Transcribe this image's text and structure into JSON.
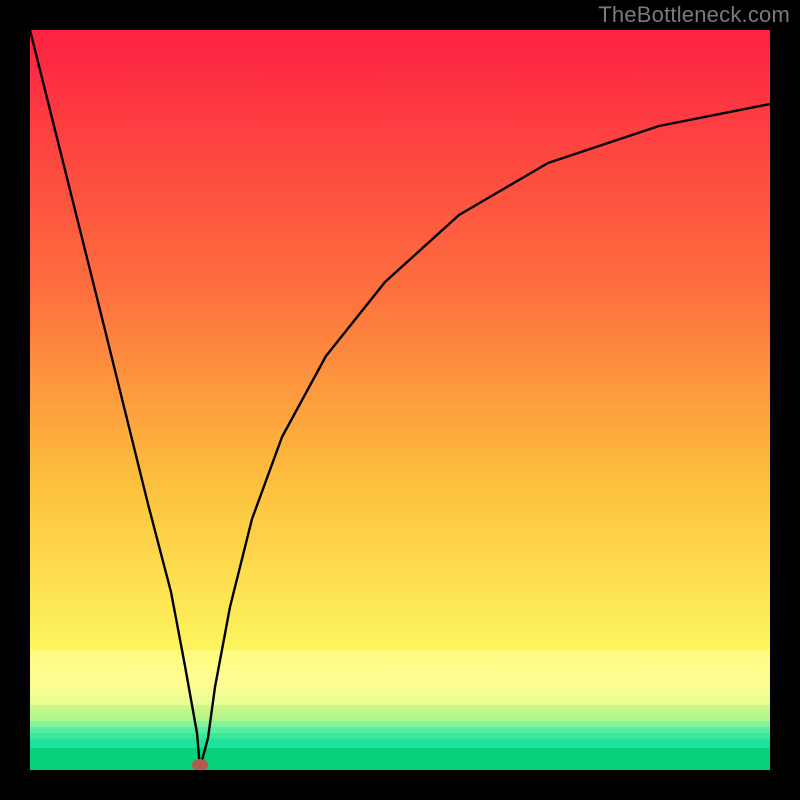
{
  "watermark": "TheBottleneck.com",
  "colors": {
    "background": "#000000",
    "curve": "#000000",
    "dot": "#b7594d",
    "green_band_top": "#2feea0",
    "green_band_bottom": "#05d27a",
    "yellow_band": "#fffb86",
    "grad_top": "#fd2142",
    "grad_mid1": "#fd6f3e",
    "grad_mid2": "#fdc23e",
    "grad_mid3": "#fdf65e"
  },
  "chart_data": {
    "type": "line",
    "title": "",
    "xlabel": "",
    "ylabel": "",
    "ylim": [
      0,
      100
    ],
    "xlim": [
      0,
      100
    ],
    "series": [
      {
        "name": "curve",
        "x": [
          0,
          5,
          10,
          13,
          16,
          19,
          21,
          22.5,
          23,
          24,
          25,
          27,
          30,
          34,
          40,
          48,
          58,
          70,
          85,
          100
        ],
        "values": [
          100,
          80,
          60,
          48,
          36,
          24,
          14,
          5,
          0,
          4,
          11,
          22,
          34,
          45,
          56,
          66,
          75,
          82,
          87,
          90
        ]
      }
    ],
    "annotations": [
      {
        "type": "dot",
        "x": 23,
        "y": 0
      }
    ]
  }
}
